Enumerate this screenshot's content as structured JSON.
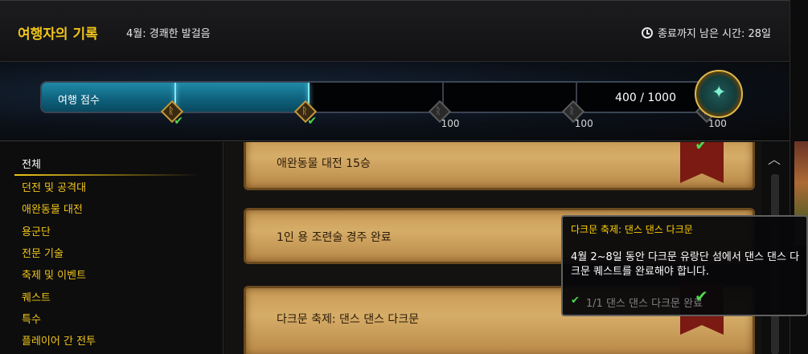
{
  "header": {
    "title": "여행자의 기록",
    "subtitle": "4월: 경쾌한 발걸음",
    "time_label": "종료까지 남은 시간: 28일",
    "icon": "clock-icon"
  },
  "progress": {
    "label": "여행 점수",
    "value_text": "400 / 1000",
    "fraction": 0.4,
    "milestones": [
      {
        "completed": true,
        "reward": ""
      },
      {
        "completed": true,
        "reward": ""
      },
      {
        "completed": false,
        "reward": "100"
      },
      {
        "completed": false,
        "reward": "100"
      },
      {
        "completed": false,
        "reward": "100"
      }
    ],
    "fill_color": "#1f8aa8"
  },
  "sidebar": {
    "items": [
      {
        "label": "전체",
        "active": true
      },
      {
        "label": "던전 및 공격대",
        "active": false
      },
      {
        "label": "애완동물 대전",
        "active": false
      },
      {
        "label": "용군단",
        "active": false
      },
      {
        "label": "전문 기술",
        "active": false
      },
      {
        "label": "축제 및 이벤트",
        "active": false
      },
      {
        "label": "퀘스트",
        "active": false
      },
      {
        "label": "특수",
        "active": false
      },
      {
        "label": "플레이어 간 전투",
        "active": false
      }
    ],
    "accent_color": "#f0c419"
  },
  "activities": [
    {
      "label": "애완동물 대전 15승",
      "completed": true
    },
    {
      "label": "1인 용 조련술 경주 완료",
      "completed": false
    },
    {
      "label": "다크문 축제: 댄스 댄스 다크문",
      "completed": true
    }
  ],
  "tooltip": {
    "title": "다크문 축제: 댄스 댄스 다크문",
    "description": "4월 2~8일 동안 다크문 유랑단 섬에서 댄스 댄스 다크문 퀘스트를 완료해야 합니다.",
    "criteria": "1/1 댄스 댄스 다크문 완료"
  }
}
